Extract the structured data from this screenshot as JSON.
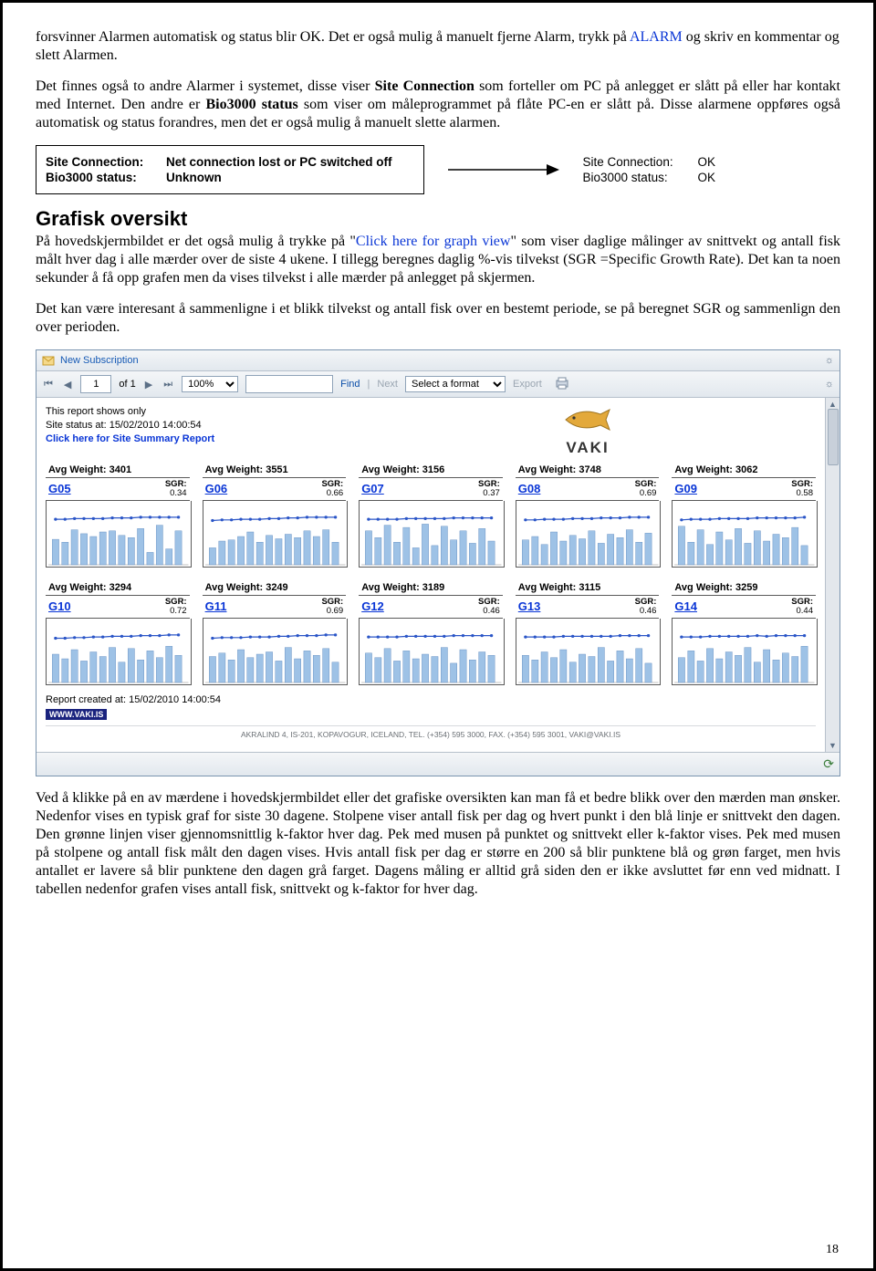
{
  "intro": {
    "seg1": "forsvinner Alarmen automatisk og status blir OK. Det er også mulig å manuelt fjerne Alarm, trykk på ",
    "alarm_link": "ALARM",
    "seg2": " og skriv en kommentar og slett Alarmen."
  },
  "para2": {
    "seg1": "Det finnes også to andre Alarmer i systemet, disse viser ",
    "bold1": "Site Connection",
    "seg2": " som forteller om PC på anlegget er slått på eller har kontakt med Internet. Den andre er ",
    "bold2": "Bio3000 status",
    "seg3": " som viser om måleprogrammet på flåte PC-en er slått på. Disse alarmene oppføres også automatisk og status forandres, men det er også mulig å manuelt slette alarmen."
  },
  "status_box": {
    "site_lbl": "Site Connection:",
    "site_val": "Net connection lost or PC switched off",
    "bio_lbl": "Bio3000 status:",
    "bio_val": "Unknown"
  },
  "status_right": {
    "site_lbl": "Site Connection:",
    "site_val": "OK",
    "bio_lbl": "Bio3000 status:",
    "bio_val": "OK"
  },
  "section_heading": "Grafisk oversikt",
  "section_para1": {
    "seg1": "På hovedskjermbildet er det også mulig å trykke på \"",
    "link": "Click here for graph view",
    "seg2": "\" som viser daglige målinger av snittvekt og antall fisk målt hver dag i alle mærder over de siste 4 ukene. I tillegg beregnes daglig %-vis tilvekst (SGR =Specific Growth Rate). Det kan ta noen sekunder å få opp grafen men da vises tilvekst i alle mærder på anlegget på skjermen."
  },
  "section_para2": "Det kan være interesant å sammenligne i et blikk tilvekst og antall fisk over en bestemt periode, se på beregnet SGR og sammenlign den over perioden.",
  "report": {
    "new_sub": "New Subscription",
    "page_current": "1",
    "of_label": "of 1",
    "zoom": "100%",
    "find": "Find",
    "next": "Next",
    "format_placeholder": "Select a format",
    "export": "Export",
    "shows_only": "This report shows only",
    "status_at": "Site status at: 15/02/2010 14:00:54",
    "summary_link": "Click here for Site Summary Report",
    "logo_text": "VAKI",
    "created": "Report created at: 15/02/2010 14:00:54",
    "vakis": "WWW.VAKI.IS",
    "corp": "AKRALIND 4, IS-201, KOPAVOGUR, ICELAND, TEL. (+354) 595 3000, FAX. (+354) 595 3001, VAKI@VAKI.IS"
  },
  "chart_data": [
    {
      "code": "G05",
      "avg_weight": 3401,
      "sgr": 0.34,
      "type": "line-bar",
      "bars": [
        45,
        40,
        62,
        55,
        50,
        58,
        60,
        52,
        48,
        64,
        22,
        70,
        28,
        60
      ],
      "line": [
        36,
        36,
        37,
        37,
        37,
        37,
        38,
        38,
        38,
        39,
        39,
        39,
        39,
        39
      ]
    },
    {
      "code": "G06",
      "avg_weight": 3551,
      "sgr": 0.66,
      "type": "line-bar",
      "bars": [
        30,
        42,
        44,
        50,
        58,
        40,
        52,
        46,
        54,
        48,
        60,
        50,
        62,
        40
      ],
      "line": [
        34,
        35,
        35,
        36,
        36,
        36,
        37,
        37,
        38,
        38,
        39,
        39,
        39,
        39
      ]
    },
    {
      "code": "G07",
      "avg_weight": 3156,
      "sgr": 0.37,
      "type": "line-bar",
      "bars": [
        60,
        48,
        70,
        40,
        66,
        30,
        72,
        34,
        68,
        44,
        60,
        38,
        64,
        42
      ],
      "line": [
        36,
        36,
        36,
        36,
        37,
        37,
        37,
        37,
        37,
        38,
        38,
        38,
        38,
        38
      ]
    },
    {
      "code": "G08",
      "avg_weight": 3748,
      "sgr": 0.69,
      "type": "line-bar",
      "bars": [
        44,
        50,
        36,
        58,
        42,
        52,
        46,
        60,
        38,
        54,
        48,
        62,
        40,
        56
      ],
      "line": [
        35,
        35,
        36,
        36,
        36,
        37,
        37,
        37,
        38,
        38,
        38,
        39,
        39,
        39
      ]
    },
    {
      "code": "G09",
      "avg_weight": 3062,
      "sgr": 0.58,
      "type": "line-bar",
      "bars": [
        68,
        40,
        62,
        36,
        58,
        44,
        64,
        38,
        60,
        42,
        54,
        48,
        66,
        34
      ],
      "line": [
        35,
        36,
        36,
        36,
        37,
        37,
        37,
        37,
        38,
        38,
        38,
        38,
        38,
        39
      ]
    },
    {
      "code": "G10",
      "avg_weight": 3294,
      "sgr": 0.72,
      "type": "line-bar",
      "bars": [
        50,
        42,
        58,
        38,
        54,
        46,
        62,
        36,
        60,
        40,
        56,
        44,
        64,
        48
      ],
      "line": [
        34,
        34,
        35,
        35,
        36,
        36,
        37,
        37,
        37,
        38,
        38,
        38,
        39,
        39
      ]
    },
    {
      "code": "G11",
      "avg_weight": 3249,
      "sgr": 0.69,
      "type": "line-bar",
      "bars": [
        46,
        52,
        40,
        58,
        44,
        50,
        54,
        38,
        62,
        42,
        56,
        48,
        60,
        36
      ],
      "line": [
        34,
        35,
        35,
        35,
        36,
        36,
        36,
        37,
        37,
        38,
        38,
        38,
        39,
        39
      ]
    },
    {
      "code": "G12",
      "avg_weight": 3189,
      "sgr": 0.46,
      "type": "line-bar",
      "bars": [
        52,
        44,
        60,
        38,
        56,
        42,
        50,
        46,
        62,
        34,
        58,
        40,
        54,
        48
      ],
      "line": [
        36,
        36,
        36,
        36,
        37,
        37,
        37,
        37,
        37,
        38,
        38,
        38,
        38,
        38
      ]
    },
    {
      "code": "G13",
      "avg_weight": 3115,
      "sgr": 0.46,
      "type": "line-bar",
      "bars": [
        48,
        40,
        54,
        44,
        58,
        36,
        50,
        46,
        62,
        38,
        56,
        42,
        60,
        34
      ],
      "line": [
        36,
        36,
        36,
        36,
        37,
        37,
        37,
        37,
        37,
        37,
        38,
        38,
        38,
        38
      ]
    },
    {
      "code": "G14",
      "avg_weight": 3259,
      "sgr": 0.44,
      "type": "line-bar",
      "bars": [
        44,
        56,
        38,
        60,
        42,
        54,
        48,
        62,
        36,
        58,
        40,
        52,
        46,
        64
      ],
      "line": [
        36,
        36,
        36,
        37,
        37,
        37,
        37,
        37,
        38,
        37,
        38,
        38,
        38,
        38
      ]
    }
  ],
  "chart_labels": {
    "avg_weight_prefix": "Avg Weight: ",
    "sgr_label": "SGR:"
  },
  "bottom_para": "Ved å klikke på en av mærdene i hovedskjermbildet eller det grafiske oversikten kan man få et bedre blikk over den mærden man ønsker. Nedenfor vises en typisk graf for siste 30 dagene. Stolpene viser antall fisk per dag og hvert punkt i den blå linje er snittvekt den dagen. Den grønne linjen viser gjennomsnittlig k-faktor hver dag. Pek med musen på punktet og snittvekt eller k-faktor vises. Pek med musen på stolpene og antall fisk målt den dagen vises. Hvis antall fisk per dag er større en 200 så blir punktene blå og grøn farget, men hvis antallet er lavere så blir punktene den dagen grå farget. Dagens måling er alltid grå siden den er ikke avsluttet før enn ved midnatt. I tabellen nedenfor grafen vises antall fisk, snittvekt og k-faktor for hver dag.",
  "page_number": "18"
}
